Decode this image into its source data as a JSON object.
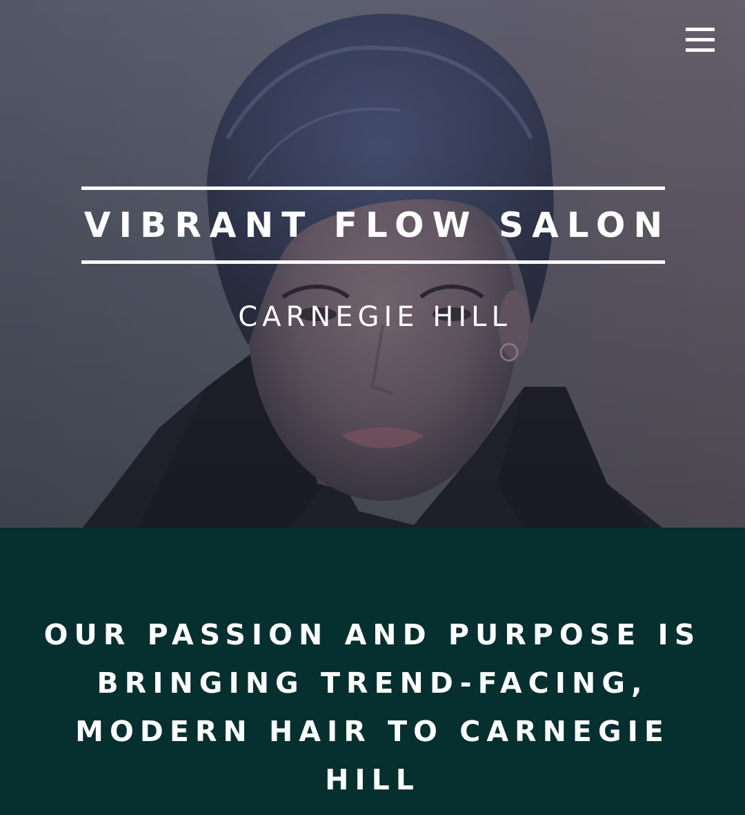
{
  "header": {
    "menu_icon": "hamburger-menu-icon"
  },
  "hero": {
    "title": "VIBRANT FLOW SALON",
    "subtitle": "CARNEGIE HILL"
  },
  "mission": {
    "text": "OUR PASSION AND PURPOSE IS BRINGING TREND-FACING, MODERN HAIR TO CARNEGIE HILL"
  },
  "colors": {
    "mission_background": "#062f2f",
    "text": "#ffffff"
  }
}
